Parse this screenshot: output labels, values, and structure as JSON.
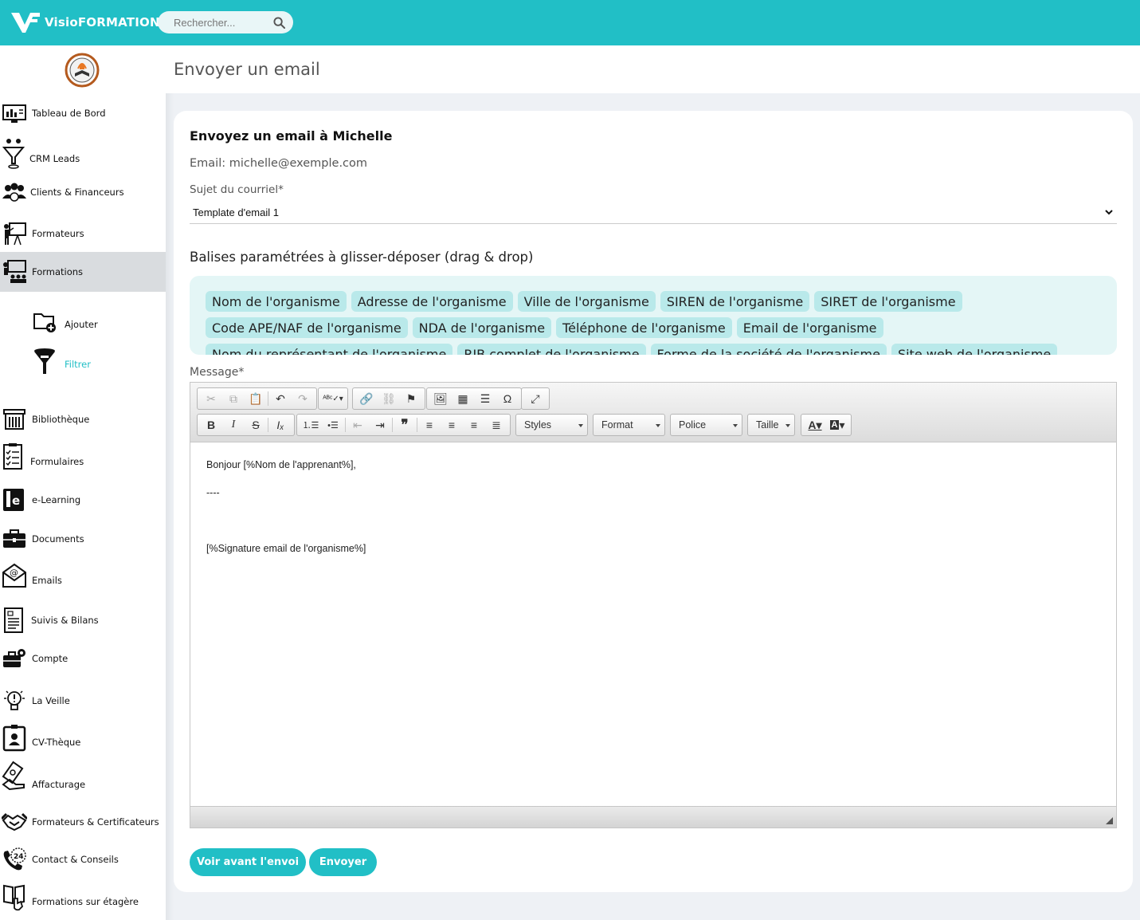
{
  "app": {
    "name": "VisioFORMATION",
    "brand_color": "#21bfc6"
  },
  "search": {
    "placeholder": "Rechercher..."
  },
  "sidebar": {
    "items": [
      {
        "label": "Tableau de Bord",
        "icon": "dashboard-icon"
      },
      {
        "label": "CRM Leads",
        "icon": "funnel-people-icon"
      },
      {
        "label": "Clients & Financeurs",
        "icon": "group-icon"
      },
      {
        "label": "Formateurs",
        "icon": "trainer-board-icon"
      },
      {
        "label": "Formations",
        "icon": "training-icon",
        "active": true
      },
      {
        "label": "Bibliothèque",
        "icon": "library-icon"
      },
      {
        "label": "Formulaires",
        "icon": "form-checklist-icon"
      },
      {
        "label": "e-Learning",
        "icon": "elearning-icon"
      },
      {
        "label": "Documents",
        "icon": "briefcase-icon"
      },
      {
        "label": "Emails",
        "icon": "email-icon"
      },
      {
        "label": "Suivis & Bilans",
        "icon": "report-icon"
      },
      {
        "label": "Compte",
        "icon": "account-gear-icon"
      },
      {
        "label": "La Veille",
        "icon": "lightbulb-icon"
      },
      {
        "label": "CV-Thèque",
        "icon": "cv-badge-icon"
      },
      {
        "label": "Affacturage",
        "icon": "money-hand-icon"
      },
      {
        "label": "Formateurs & Certificateurs",
        "icon": "handshake-icon"
      },
      {
        "label": "Contact & Conseils",
        "icon": "phone-24-icon"
      },
      {
        "label": "Formations sur étagère",
        "icon": "book-hand-icon"
      }
    ],
    "sub_items": [
      {
        "label": "Ajouter",
        "icon": "folder-add-icon"
      },
      {
        "label": "Filtrer",
        "icon": "filter-icon",
        "active": true
      }
    ]
  },
  "page": {
    "title": "Envoyer un email"
  },
  "form": {
    "heading": "Envoyez un email à Michelle",
    "email_line": "Email: michelle@exemple.com",
    "subject_label": "Sujet du courriel*",
    "subject_value": "Template d'email 1",
    "tags_title": "Balises paramétrées à glisser-déposer (drag & drop)",
    "tag_rows": [
      [
        "Nom de l'organisme",
        "Adresse de l'organisme",
        "Ville de l'organisme",
        "SIREN de l'organisme",
        "SIRET de l'organisme"
      ],
      [
        "Code APE/NAF de l'organisme",
        "NDA de l'organisme",
        "Téléphone de l'organisme",
        "Email de l'organisme"
      ],
      [
        "Nom du représentant de l'organisme",
        "RIB complet de l'organisme",
        "Forme de la société de l'organisme",
        "Site web de l'organisme"
      ]
    ],
    "message_label": "Message*",
    "toolbar_combos": [
      "Styles",
      "Format",
      "Police",
      "Taille"
    ],
    "message_lines": [
      "Bonjour [%Nom de l'apprenant%],",
      "----",
      "",
      "[%Signature email de l'organisme%]"
    ],
    "preview_button": "Voir avant l'envoi",
    "send_button": "Envoyer"
  }
}
